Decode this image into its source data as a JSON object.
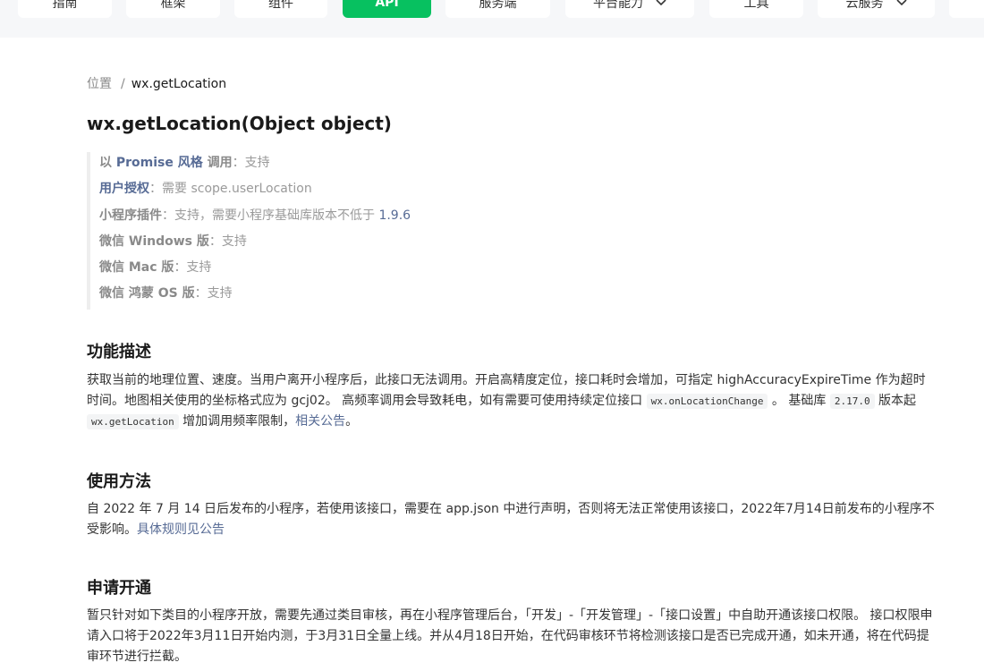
{
  "nav": {
    "tabs": [
      {
        "label": "指南",
        "has_dropdown": false
      },
      {
        "label": "框架",
        "has_dropdown": false
      },
      {
        "label": "组件",
        "has_dropdown": false
      },
      {
        "label": "API",
        "has_dropdown": false,
        "active": true
      },
      {
        "label": "服务端",
        "has_dropdown": false
      },
      {
        "label": "平台能力",
        "has_dropdown": true
      },
      {
        "label": "工具",
        "has_dropdown": false
      },
      {
        "label": "云服务",
        "has_dropdown": true
      }
    ],
    "active_color": "#07c160"
  },
  "breadcrumb": {
    "parent": "位置",
    "separator": "/",
    "current": "wx.getLocation"
  },
  "page_title": "wx.getLocation(Object object)",
  "meta": {
    "promise": {
      "pre": "以 ",
      "key": "Promise 风格",
      "post": " 调用",
      "value": "：支持"
    },
    "auth": {
      "key": "用户授权",
      "value": "：需要 scope.userLocation"
    },
    "plugin": {
      "key": "小程序插件",
      "value": "：支持，需要小程序基础库版本不低于 ",
      "version": "1.9.6"
    },
    "windows": {
      "key": "微信 Windows 版",
      "value": "：支持"
    },
    "mac": {
      "key": "微信 Mac 版",
      "value": "：支持"
    },
    "harmony": {
      "key": "微信 鸿蒙 OS 版",
      "value": "：支持"
    }
  },
  "sections": {
    "desc": {
      "title": "功能描述",
      "text1": "获取当前的地理位置、速度。当用户离开小程序后，此接口无法调用。开启高精度定位，接口耗时会增加，可指定 highAccuracyExpireTime 作为超时时间。地图相关使用的坐标格式应为 gcj02。 高频率调用会导致耗电，如有需要可使用持续定位接口 ",
      "code1": "wx.onLocationChange",
      "text2": " 。 基础库 ",
      "code2": "2.17.0",
      "text3": " 版本起 ",
      "code3": "wx.getLocation",
      "text4": " 增加调用频率限制，",
      "link": "相关公告",
      "text5": "。"
    },
    "usage": {
      "title": "使用方法",
      "text": "自 2022 年 7 月 14 日后发布的小程序，若使用该接口，需要在 app.json 中进行声明，否则将无法正常使用该接口，2022年7月14日前发布的小程序不受影响。",
      "link": "具体规则见公告"
    },
    "apply": {
      "title": "申请开通",
      "text": "暂只针对如下类目的小程序开放，需要先通过类目审核，再在小程序管理后台，「开发」-「开发管理」-「接口设置」中自助开通该接口权限。 接口权限申请入口将于2022年3月11日开始内测，于3月31日全量上线。并从4月18日开始，在代码审核环节将检测该接口是否已完成开通，如未开通，将在代码提审环节进行拦截。"
    }
  },
  "colors": {
    "link": "#576b95",
    "muted": "#9a9a9a",
    "text": "#333333"
  }
}
